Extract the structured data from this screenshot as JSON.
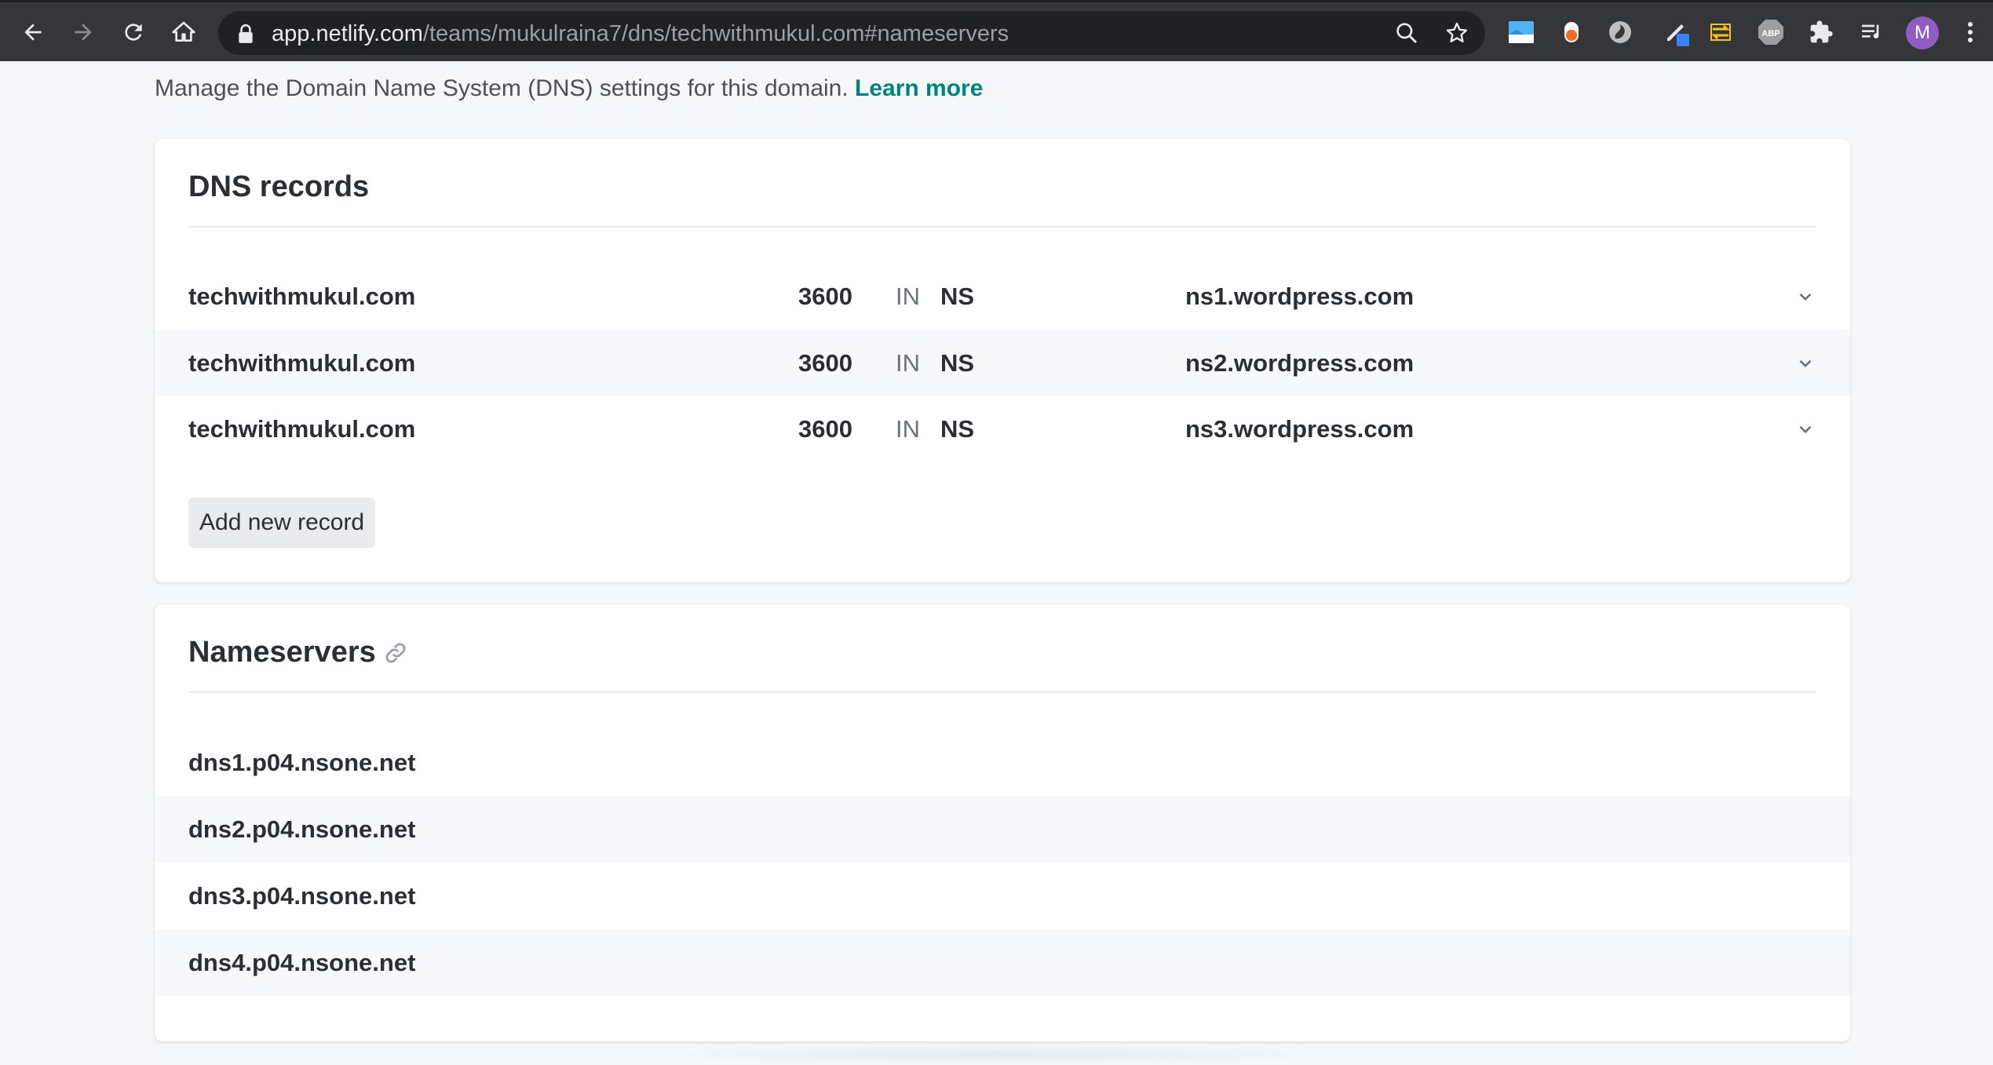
{
  "browser": {
    "url_host": "app.netlify.com",
    "url_path": "/teams/mukulraina7/dns/techwithmukul.com#nameservers",
    "avatar_letter": "M",
    "icons": [
      "back-arrow-icon",
      "forward-arrow-icon",
      "reload-icon",
      "home-icon",
      "lock-icon",
      "zoom-icon",
      "bookmark-star-icon",
      "extension-icons",
      "puzzle-icon",
      "media-queue-icon",
      "kebab-menu-icon"
    ]
  },
  "intro": {
    "text": "Manage the Domain Name System (DNS) settings for this domain.",
    "link": "Learn more"
  },
  "dns_records": {
    "title": "DNS records",
    "records": [
      {
        "name": "techwithmukul.com",
        "ttl": "3600",
        "class": "IN",
        "type": "NS",
        "value": "ns1.wordpress.com"
      },
      {
        "name": "techwithmukul.com",
        "ttl": "3600",
        "class": "IN",
        "type": "NS",
        "value": "ns2.wordpress.com"
      },
      {
        "name": "techwithmukul.com",
        "ttl": "3600",
        "class": "IN",
        "type": "NS",
        "value": "ns3.wordpress.com"
      }
    ],
    "add_button": "Add new record"
  },
  "nameservers": {
    "title": "Nameservers",
    "servers": [
      "dns1.p04.nsone.net",
      "dns2.p04.nsone.net",
      "dns3.p04.nsone.net",
      "dns4.p04.nsone.net"
    ]
  },
  "colors": {
    "accent": "#00837b",
    "text": "#2b2f33",
    "chrome": "#35363a"
  }
}
